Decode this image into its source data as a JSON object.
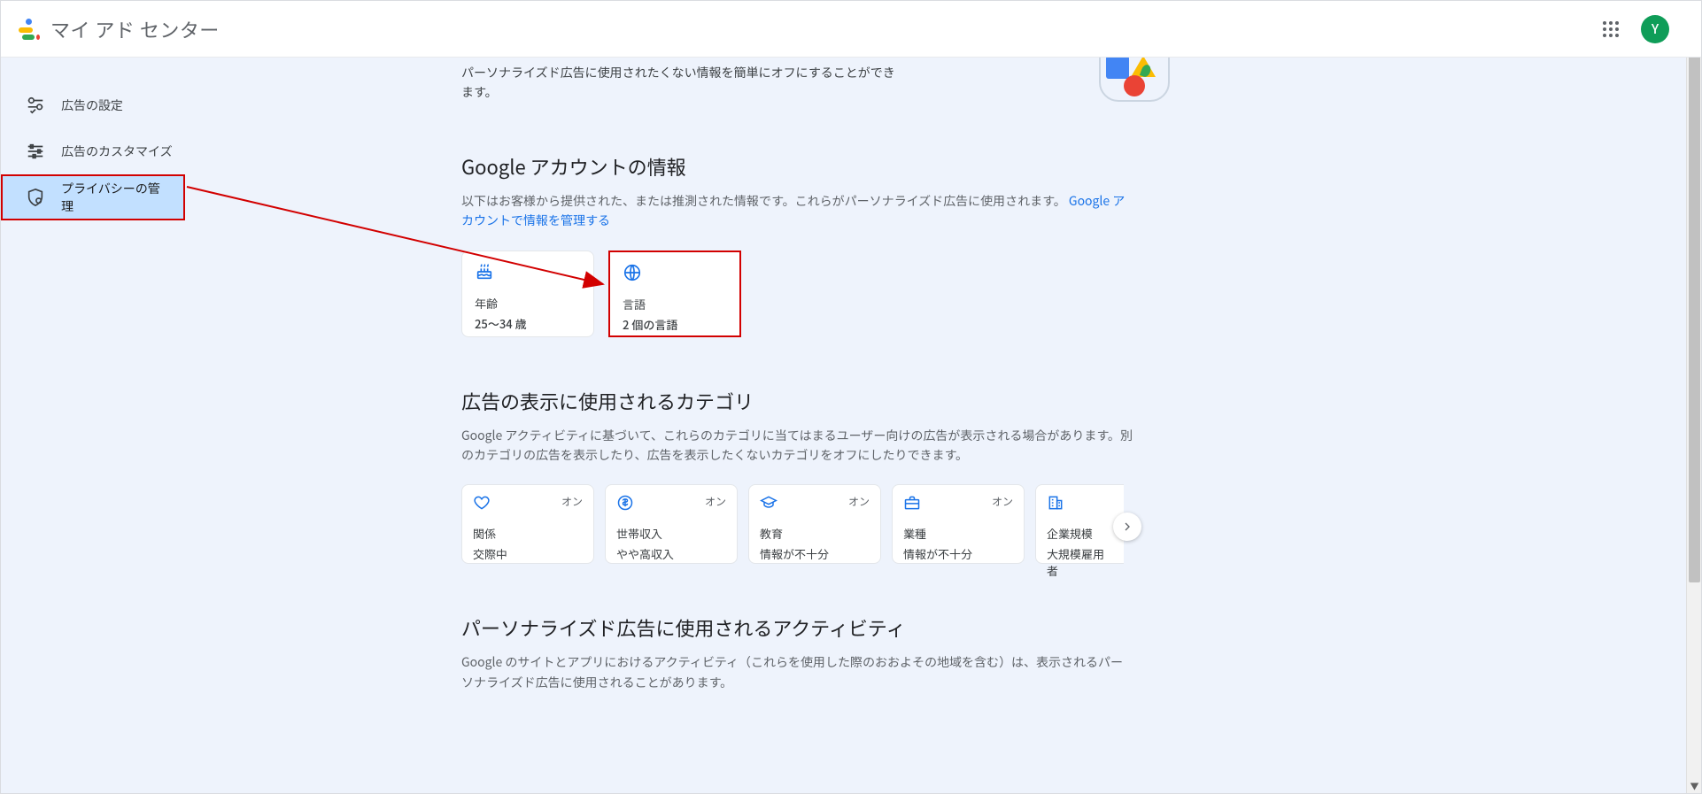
{
  "header": {
    "app_title": "マイ アド センター",
    "avatar_initial": "Y"
  },
  "sidebar": {
    "items": [
      {
        "label": "広告の設定"
      },
      {
        "label": "広告のカスタマイズ"
      },
      {
        "label": "プライバシーの管理"
      }
    ]
  },
  "intro": {
    "text": "パーソナライズド広告に使用されたくない情報を簡単にオフにすることができます。"
  },
  "account_section": {
    "heading": "Google アカウントの情報",
    "desc_prefix": "以下はお客様から提供された、または推測された情報です。これらがパーソナライズド広告に使用されます。",
    "link_text": "Google アカウントで情報を管理する",
    "cards": [
      {
        "label": "年齢",
        "value": "25～34 歳"
      },
      {
        "label": "言語",
        "value": "2 個の言語"
      }
    ]
  },
  "categories_section": {
    "heading": "広告の表示に使用されるカテゴリ",
    "desc": "Google アクティビティに基づいて、これらのカテゴリに当てはまるユーザー向けの広告が表示される場合があります。別のカテゴリの広告を表示したり、広告を表示したくないカテゴリをオフにしたりできます。",
    "status_on": "オン",
    "cards": [
      {
        "name": "関係",
        "value": "交際中"
      },
      {
        "name": "世帯収入",
        "value": "やや高収入"
      },
      {
        "name": "教育",
        "value": "情報が不十分"
      },
      {
        "name": "業種",
        "value": "情報が不十分"
      },
      {
        "name": "企業規模",
        "value": "大規模雇用者"
      }
    ]
  },
  "activity_section": {
    "heading": "パーソナライズド広告に使用されるアクティビティ",
    "desc": "Google のサイトとアプリにおけるアクティビティ（これらを使用した際のおおよその地域を含む）は、表示されるパーソナライズド広告に使用されることがあります。"
  }
}
